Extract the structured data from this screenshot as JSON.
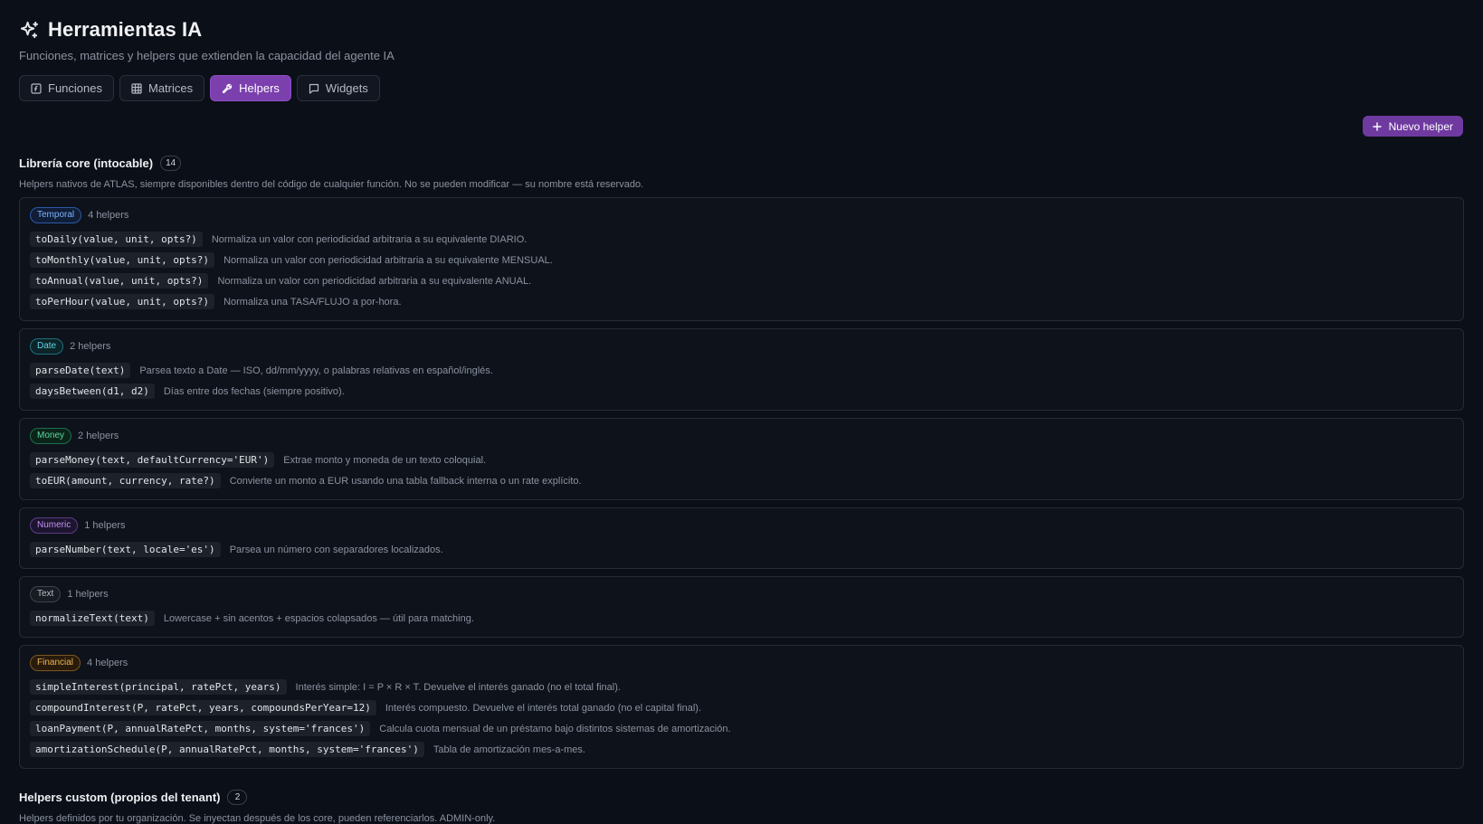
{
  "header": {
    "title": "Herramientas IA",
    "subtitle": "Funciones, matrices y helpers que extienden la capacidad del agente IA"
  },
  "tabs": [
    {
      "label": "Funciones",
      "icon": "function-icon"
    },
    {
      "label": "Matrices",
      "icon": "grid-icon"
    },
    {
      "label": "Helpers",
      "icon": "wrench-icon",
      "active": true
    },
    {
      "label": "Widgets",
      "icon": "chat-icon"
    }
  ],
  "new_helper_label": "Nuevo helper",
  "core": {
    "title": "Librería core (intocable)",
    "count": "14",
    "description": "Helpers nativos de ATLAS, siempre disponibles dentro del código de cualquier función. No se pueden modificar — su nombre está reservado.",
    "groups": [
      {
        "category": "Temporal",
        "count_label": "4 helpers",
        "color": "#7fb4ff",
        "items": [
          {
            "sig": "toDaily(value, unit, opts?)",
            "desc": "Normaliza un valor con periodicidad arbitraria a su equivalente DIARIO."
          },
          {
            "sig": "toMonthly(value, unit, opts?)",
            "desc": "Normaliza un valor con periodicidad arbitraria a su equivalente MENSUAL."
          },
          {
            "sig": "toAnnual(value, unit, opts?)",
            "desc": "Normaliza un valor con periodicidad arbitraria a su equivalente ANUAL."
          },
          {
            "sig": "toPerHour(value, unit, opts?)",
            "desc": "Normaliza una TASA/FLUJO a por-hora."
          }
        ]
      },
      {
        "category": "Date",
        "count_label": "2 helpers",
        "color": "#5fd4e6",
        "items": [
          {
            "sig": "parseDate(text)",
            "desc": "Parsea texto a Date — ISO, dd/mm/yyyy, o palabras relativas en español/inglés."
          },
          {
            "sig": "daysBetween(d1, d2)",
            "desc": "Días entre dos fechas (siempre positivo)."
          }
        ]
      },
      {
        "category": "Money",
        "count_label": "2 helpers",
        "color": "#5ed6a0",
        "items": [
          {
            "sig": "parseMoney(text, defaultCurrency='EUR')",
            "desc": "Extrae monto y moneda de un texto coloquial."
          },
          {
            "sig": "toEUR(amount, currency, rate?)",
            "desc": "Convierte un monto a EUR usando una tabla fallback interna o un rate explícito."
          }
        ]
      },
      {
        "category": "Numeric",
        "count_label": "1 helpers",
        "color": "#c292f0",
        "items": [
          {
            "sig": "parseNumber(text, locale='es')",
            "desc": "Parsea un número con separadores localizados."
          }
        ]
      },
      {
        "category": "Text",
        "count_label": "1 helpers",
        "color": "#b8bec8",
        "items": [
          {
            "sig": "normalizeText(text)",
            "desc": "Lowercase + sin acentos + espacios colapsados — útil para matching."
          }
        ]
      },
      {
        "category": "Financial",
        "count_label": "4 helpers",
        "color": "#f0b458",
        "items": [
          {
            "sig": "simpleInterest(principal, ratePct, years)",
            "desc": "Interés simple: I = P × R × T. Devuelve el interés ganado (no el total final)."
          },
          {
            "sig": "compoundInterest(P, ratePct, years, compoundsPerYear=12)",
            "desc": "Interés compuesto. Devuelve el interés total ganado (no el capital final)."
          },
          {
            "sig": "loanPayment(P, annualRatePct, months, system='frances')",
            "desc": "Calcula cuota mensual de un préstamo bajo distintos sistemas de amortización."
          },
          {
            "sig": "amortizationSchedule(P, annualRatePct, months, system='frances')",
            "desc": "Tabla de amortización mes-a-mes."
          }
        ]
      }
    ]
  },
  "custom": {
    "title": "Helpers custom (propios del tenant)",
    "count": "2",
    "description": "Helpers definidos por tu organización. Se inyectan después de los core, pueden referenciarlos. ADMIN-only."
  }
}
